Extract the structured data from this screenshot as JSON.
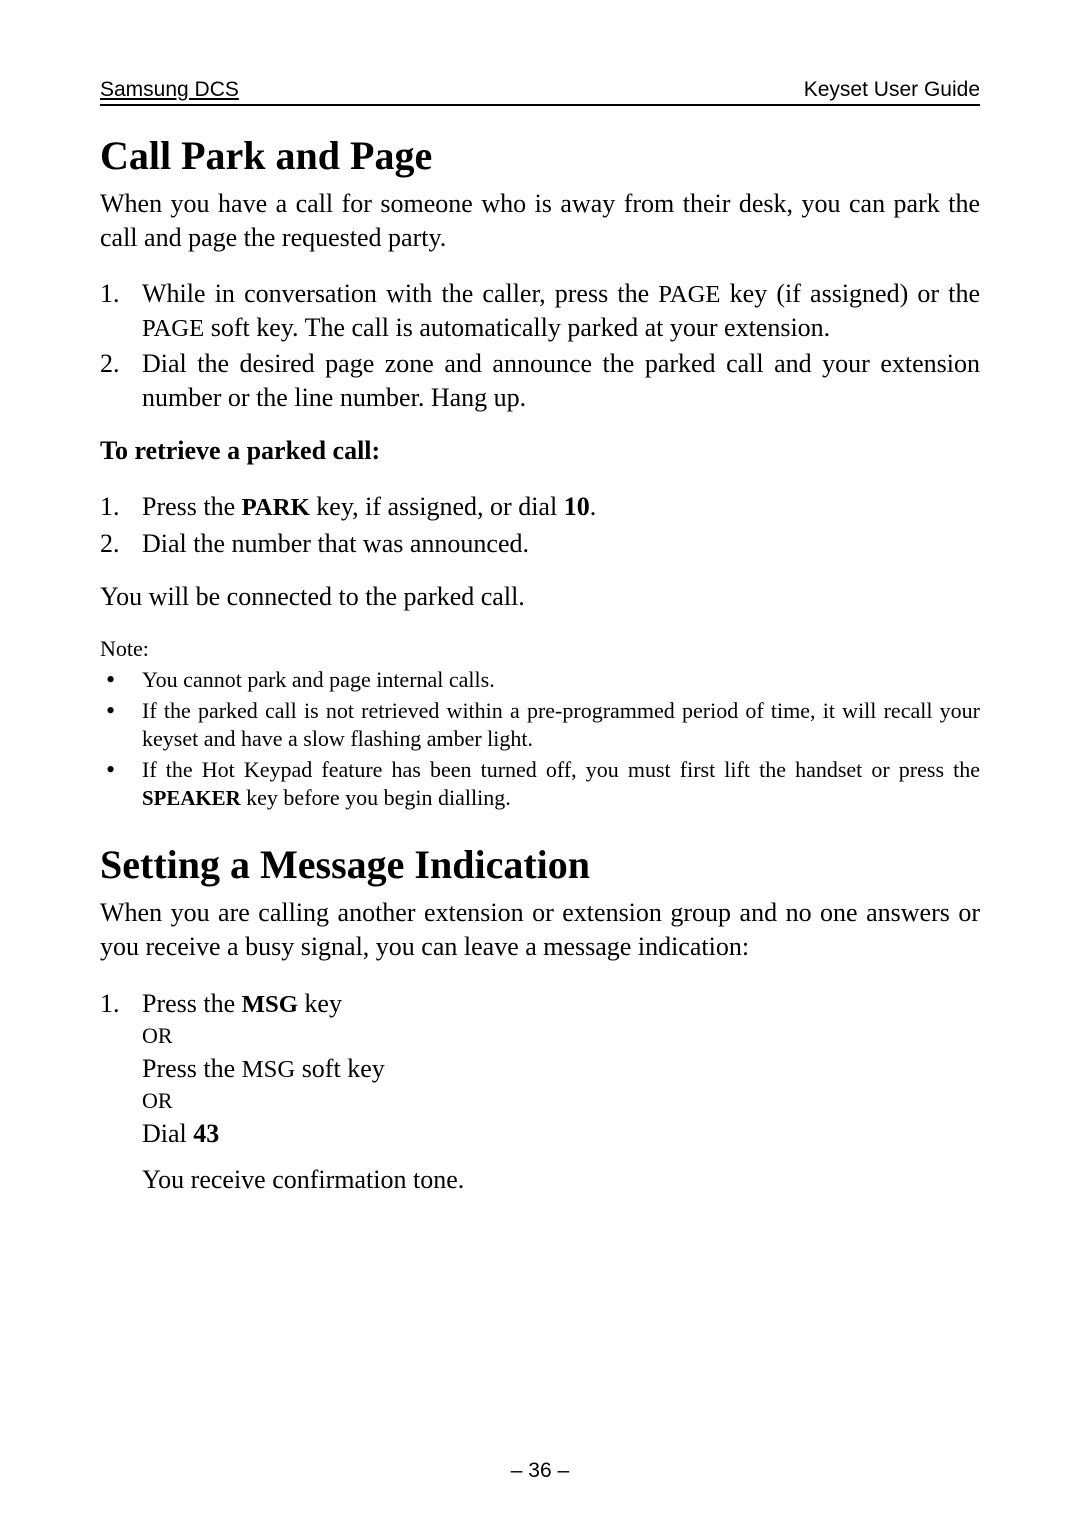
{
  "header": {
    "left": "Samsung DCS",
    "right": "Keyset User Guide"
  },
  "section1": {
    "heading": "Call Park and Page",
    "intro": "When you have a call for someone who is away from their desk, you can park the call and page the requested party.",
    "steps": [
      {
        "num": "1.",
        "pre": "While in conversation with the caller, press the ",
        "key1": "PAGE",
        "mid": " key (if assigned) or the ",
        "key2": "PAGE",
        "post": " soft key. The call is automatically parked at your extension."
      },
      {
        "num": "2.",
        "text": "Dial the desired page zone and announce the parked call and your extension number or the line number. Hang up."
      }
    ],
    "retrieve_heading": "To retrieve a parked call:",
    "retrieve_steps": [
      {
        "num": "1.",
        "pre": "Press the ",
        "key": "PARK",
        "mid": " key, if assigned, or dial ",
        "bold": "10",
        "post": "."
      },
      {
        "num": "2.",
        "text": "Dial the number that was announced."
      }
    ],
    "connected": "You will be connected to the parked call.",
    "note_label": "Note:",
    "notes": [
      {
        "text": "You cannot park and page internal calls."
      },
      {
        "text": "If the parked call is not retrieved within a pre-programmed period of time, it will recall your keyset and have a slow flashing amber light."
      },
      {
        "pre": "If the Hot Keypad feature has been turned off, you must first lift the handset or press the ",
        "key": "SPEAKER",
        "post": " key before you begin dialling."
      }
    ]
  },
  "section2": {
    "heading": "Setting a Message Indication",
    "intro": "When you are calling another extension or extension group and no one answers or you receive a busy signal, you can leave a message indication:",
    "step": {
      "num": "1.",
      "line1_pre": "Press the ",
      "line1_key": "MSG",
      "line1_post": " key",
      "or1": "OR",
      "line2_pre": "Press the ",
      "line2_key": "MSG",
      "line2_post": " soft key",
      "or2": "OR",
      "line3_pre": "Dial ",
      "line3_bold": "43"
    },
    "confirm": "You receive confirmation tone."
  },
  "page_number": "– 36 –"
}
